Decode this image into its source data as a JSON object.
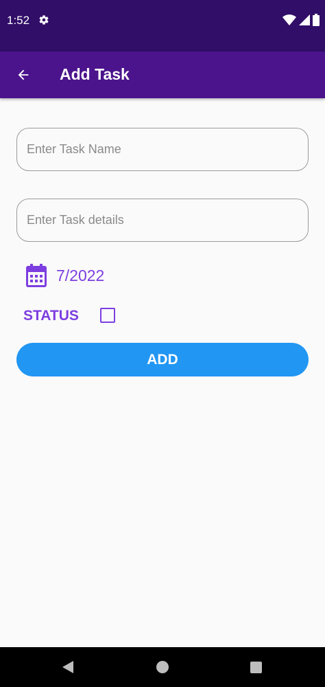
{
  "status_bar": {
    "time": "1:52",
    "icons": [
      "gear-icon",
      "wifi-icon",
      "signal-icon",
      "battery-icon"
    ]
  },
  "app_bar": {
    "title": "Add Task",
    "back_icon": "arrow-left-icon"
  },
  "form": {
    "task_name": {
      "placeholder": "Enter Task Name",
      "value": ""
    },
    "task_details": {
      "placeholder": "Enter Task details",
      "value": ""
    },
    "date": {
      "icon": "calendar-icon",
      "value": "7/2022"
    },
    "status": {
      "label": "STATUS",
      "checked": false
    },
    "add_button": {
      "label": "ADD"
    }
  },
  "nav_bar": {
    "icons": [
      "nav-back-icon",
      "nav-home-icon",
      "nav-recents-icon"
    ]
  },
  "colors": {
    "status_bar_bg": "#310e68",
    "app_bar_bg": "#4b148c",
    "accent_purple": "#7c3ee0",
    "button_blue": "#2196f3",
    "background": "#fafafa",
    "nav_bar_bg": "#000000"
  }
}
